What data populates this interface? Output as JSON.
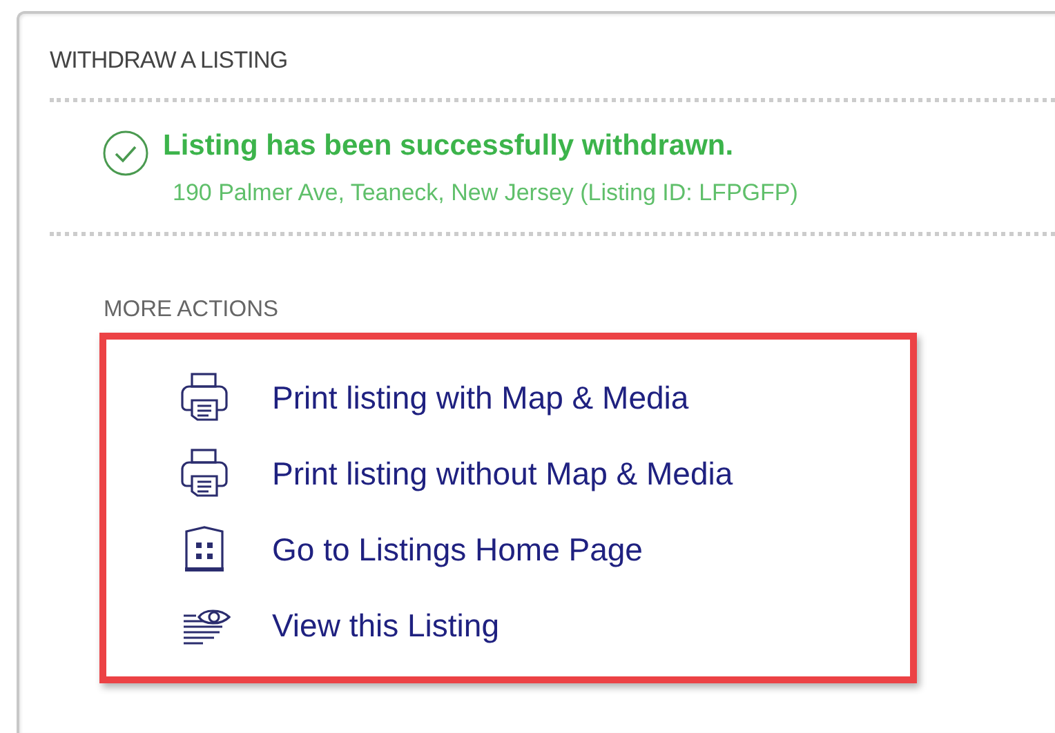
{
  "panel": {
    "title": "WITHDRAW A LISTING"
  },
  "message": {
    "heading": "Listing has been successfully withdrawn.",
    "detail": "190 Palmer Ave, Teaneck, New Jersey (Listing ID: LFPGFP)"
  },
  "more_actions": {
    "title": "MORE ACTIONS",
    "highlighted": true,
    "items": [
      {
        "kind": "print",
        "label": "Print listing with Map & Media"
      },
      {
        "kind": "print",
        "label": "Print listing without Map & Media"
      },
      {
        "kind": "building",
        "label": "Go to Listings Home Page"
      },
      {
        "kind": "view",
        "label": "View this Listing"
      }
    ]
  }
}
